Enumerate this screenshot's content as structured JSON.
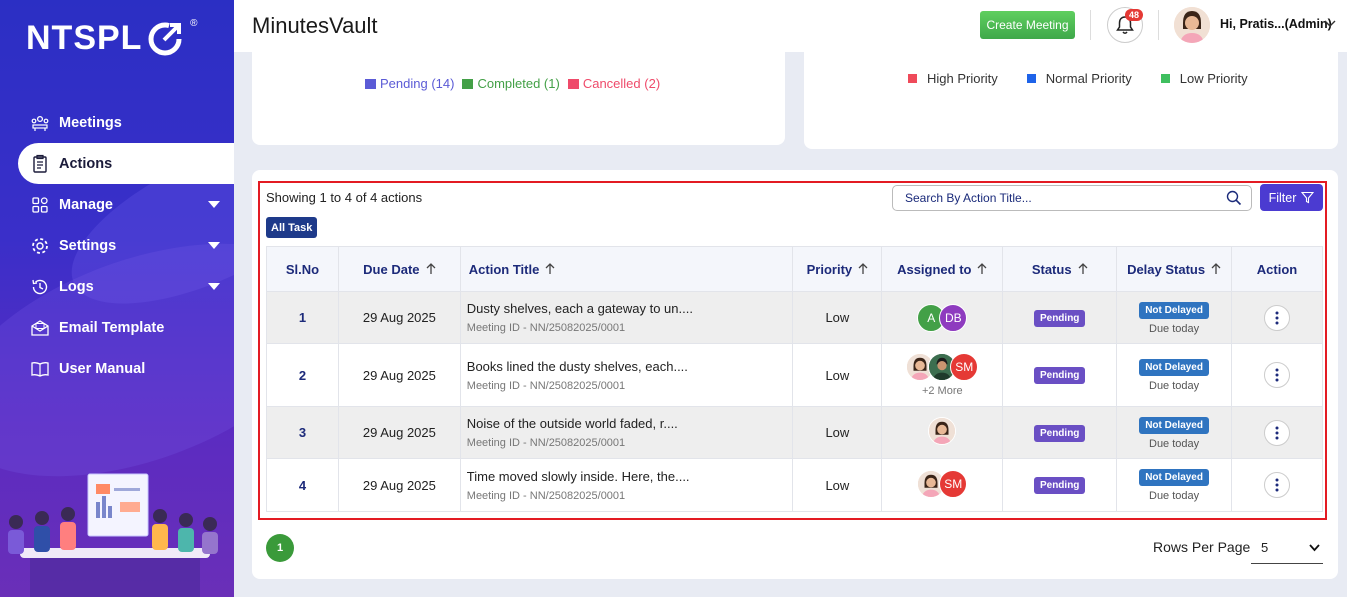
{
  "brand": {
    "name": "NTSPL",
    "reg_mark": "®"
  },
  "sidebar": {
    "items": [
      {
        "label": "Meetings",
        "icon": "meetings-icon",
        "active": false,
        "has_caret": false
      },
      {
        "label": "Actions",
        "icon": "actions-icon",
        "active": true,
        "has_caret": false
      },
      {
        "label": "Manage",
        "icon": "manage-icon",
        "active": false,
        "has_caret": true
      },
      {
        "label": "Settings",
        "icon": "settings-icon",
        "active": false,
        "has_caret": true
      },
      {
        "label": "Logs",
        "icon": "logs-icon",
        "active": false,
        "has_caret": true
      },
      {
        "label": "Email Template",
        "icon": "email-icon",
        "active": false,
        "has_caret": false
      },
      {
        "label": "User Manual",
        "icon": "book-icon",
        "active": false,
        "has_caret": false
      }
    ]
  },
  "header": {
    "title": "MinutesVault",
    "create_label": "Create Meeting",
    "notification_count": "48",
    "user_greeting": "Hi, Pratis...(Admin)"
  },
  "status_legend": [
    {
      "label": "Pending (14)",
      "color": "#5b5bd6"
    },
    {
      "label": "Completed (1)",
      "color": "#43a047"
    },
    {
      "label": "Cancelled (2)",
      "color": "#ef4a6a"
    }
  ],
  "priority_legend": [
    {
      "label": "High Priority",
      "color": "#ef4a5a"
    },
    {
      "label": "Normal Priority",
      "color": "#1e63e9"
    },
    {
      "label": "Low Priority",
      "color": "#3fbf5f"
    }
  ],
  "actions": {
    "showing_text": "Showing 1 to 4 of 4 actions",
    "search_placeholder": "Search By Action Title...",
    "filter_label": "Filter",
    "all_task_label": "All Task",
    "columns": [
      "Sl.No",
      "Due Date",
      "Action Title",
      "Priority",
      "Assigned to",
      "Status",
      "Delay Status",
      "Action"
    ],
    "rows": [
      {
        "sl": "1",
        "due": "29 Aug 2025",
        "title": "Dusty shelves, each a gateway to un....",
        "meeting_id": "Meeting ID - NN/25082025/0001",
        "priority": "Low",
        "status": "Pending",
        "delay": "Not Delayed",
        "due_note": "Due today",
        "assignees": [
          {
            "initials": "A",
            "color": "#43a047"
          },
          {
            "initials": "DB",
            "color": "#8e3bbf"
          }
        ],
        "more": ""
      },
      {
        "sl": "2",
        "due": "29 Aug 2025",
        "title": "Books lined the dusty shelves, each....",
        "meeting_id": "Meeting ID - NN/25082025/0001",
        "priority": "Low",
        "status": "Pending",
        "delay": "Not Delayed",
        "due_note": "Due today",
        "assignees": [
          {
            "initials": "",
            "color": "#f3d9c6"
          },
          {
            "initials": "",
            "color": "#2f5a3a"
          },
          {
            "initials": "SM",
            "color": "#e53935"
          }
        ],
        "more": "+2 More"
      },
      {
        "sl": "3",
        "due": "29 Aug 2025",
        "title": "Noise of the outside world faded, r....",
        "meeting_id": "Meeting ID - NN/25082025/0001",
        "priority": "Low",
        "status": "Pending",
        "delay": "Not Delayed",
        "due_note": "Due today",
        "assignees": [
          {
            "initials": "",
            "color": "#f3d9c6"
          }
        ],
        "more": ""
      },
      {
        "sl": "4",
        "due": "29 Aug 2025",
        "title": "Time moved slowly inside. Here, the....",
        "meeting_id": "Meeting ID - NN/25082025/0001",
        "priority": "Low",
        "status": "Pending",
        "delay": "Not Delayed",
        "due_note": "Due today",
        "assignees": [
          {
            "initials": "",
            "color": "#f3d9c6"
          },
          {
            "initials": "SM",
            "color": "#e53935"
          }
        ],
        "more": ""
      }
    ]
  },
  "pagination": {
    "current_page": "1",
    "rows_per_page_label": "Rows Per Page",
    "rows_per_page_value": "5"
  }
}
